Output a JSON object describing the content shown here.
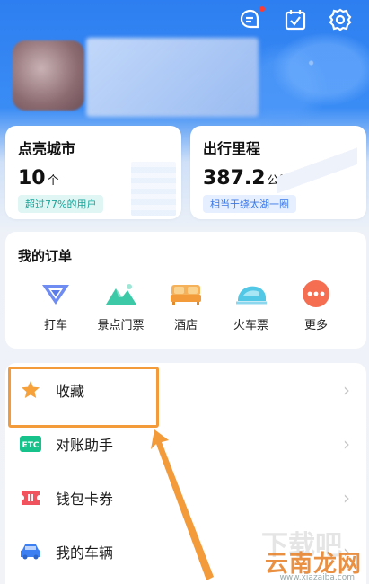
{
  "header": {
    "icons": [
      "message-icon",
      "checkin-icon",
      "settings-icon"
    ]
  },
  "stats": {
    "cities": {
      "title": "点亮城市",
      "value": "10",
      "unit": "个",
      "badge": "超过77%的用户"
    },
    "mileage": {
      "title": "出行里程",
      "value": "387.2",
      "unit": "公里",
      "badge": "相当于绕太湖一圈"
    }
  },
  "orders": {
    "title": "我的订单",
    "items": [
      {
        "label": "打车",
        "icon": "taxi-icon"
      },
      {
        "label": "景点门票",
        "icon": "scenic-ticket-icon"
      },
      {
        "label": "酒店",
        "icon": "hotel-icon"
      },
      {
        "label": "火车票",
        "icon": "train-ticket-icon"
      },
      {
        "label": "更多",
        "icon": "more-icon"
      }
    ]
  },
  "menu": {
    "items": [
      {
        "label": "收藏",
        "icon": "star-icon"
      },
      {
        "label": "对账助手",
        "icon": "etc-icon"
      },
      {
        "label": "钱包卡券",
        "icon": "coupon-icon"
      },
      {
        "label": "我的车辆",
        "icon": "car-icon"
      }
    ]
  },
  "watermark": {
    "text": "云南龙网",
    "sub": "www.xiazaiba.com",
    "bg": "下载吧"
  },
  "colors": {
    "accent": "#2d7ef0",
    "highlight": "#f39a3a",
    "star": "#f6a13a",
    "etc": "#17c28b",
    "coupon": "#f0525e"
  }
}
